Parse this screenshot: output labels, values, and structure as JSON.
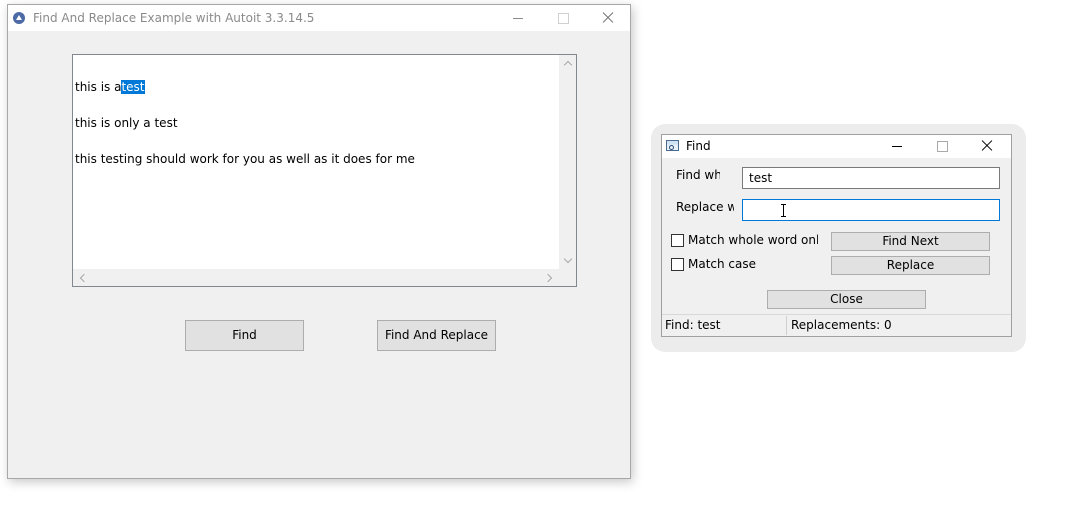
{
  "main_window": {
    "title": "Find And Replace Example with Autoit 3.3.14.5",
    "edit_lines": [
      {
        "before": "this is a",
        "selected": "test",
        "after": ""
      },
      {
        "before": "this is only a test",
        "selected": "",
        "after": ""
      },
      {
        "before": "this testing should work for you as well as it does for me",
        "selected": "",
        "after": ""
      }
    ],
    "find_button": "Find",
    "find_and_replace_button": "Find And Replace"
  },
  "find_dialog": {
    "title": "Find",
    "find_what_label": "Find what:",
    "replace_with_label": "Replace with:",
    "find_what_value": "test",
    "replace_with_value": "",
    "match_whole_word_label": "Match whole word only",
    "match_case_label": "Match case",
    "match_whole_word_checked": false,
    "match_case_checked": false,
    "find_next_button": "Find Next",
    "replace_button": "Replace",
    "close_button": "Close",
    "status_find": "Find:  test",
    "status_replacements": "Replacements: 0"
  },
  "icons": {
    "main_app_icon": "autoit-icon",
    "dialog_icon": "find-dialog-icon"
  },
  "colors": {
    "selection": "#0078d7",
    "focus_border": "#0078d7",
    "window_bg": "#f0f0f0"
  }
}
